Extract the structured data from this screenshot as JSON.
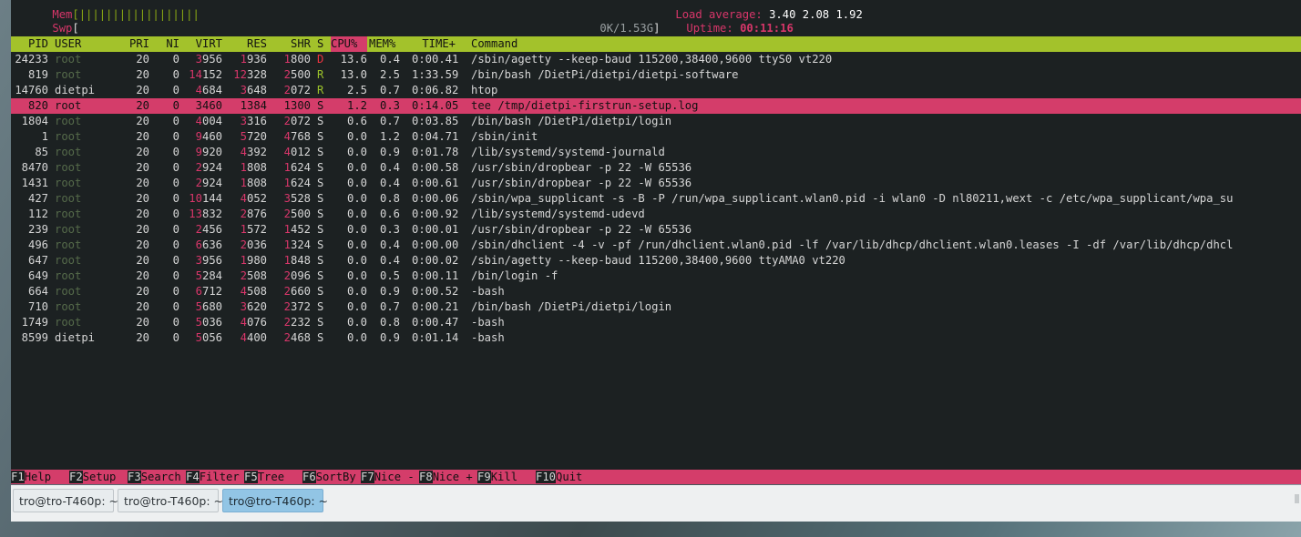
{
  "meters": {
    "mem_label": "Mem",
    "mem_bar": "[||||||||||||||||||",
    "swp_label": "Swp",
    "swp_open": "[",
    "swp_value": "0K/1.53G",
    "swp_close": "]",
    "load_label": "Load average:",
    "load_values": "3.40 2.08 1.92",
    "uptime_label": "Uptime:",
    "uptime_value": "00:11:16"
  },
  "header": {
    "pid": "PID",
    "user": "USER",
    "pri": "PRI",
    "ni": "NI",
    "virt": "VIRT",
    "res": "RES",
    "shr": "SHR",
    "s": "S",
    "cpu": "CPU%",
    "mem": "MEM%",
    "time": "TIME+",
    "command": "Command"
  },
  "processes": [
    {
      "pid": "24233",
      "user": "root",
      "pri": "20",
      "ni": "0",
      "virt_hi": "3",
      "virt": "956",
      "res_hi": "1",
      "res": "936",
      "shr_hi": "1",
      "shr": "800",
      "s": "D",
      "cpu": "13.6",
      "mem": "0.4",
      "time": "0:00.41",
      "command": "/sbin/agetty --keep-baud 115200,38400,9600 ttyS0 vt220"
    },
    {
      "pid": "819",
      "user": "root",
      "pri": "20",
      "ni": "0",
      "virt_hi": "14",
      "virt": "152",
      "res_hi": "12",
      "res": "328",
      "shr_hi": "2",
      "shr": "500",
      "s": "R",
      "cpu": "13.0",
      "mem": "2.5",
      "time": "1:33.59",
      "command": "/bin/bash /DietPi/dietpi/dietpi-software"
    },
    {
      "pid": "14760",
      "user": "dietpi",
      "pri": "20",
      "ni": "0",
      "virt_hi": "4",
      "virt": "684",
      "res_hi": "3",
      "res": "648",
      "shr_hi": "2",
      "shr": "072",
      "s": "R",
      "cpu": "2.5",
      "mem": "0.7",
      "time": "0:06.82",
      "command": "htop"
    },
    {
      "pid": "820",
      "user": "root",
      "pri": "20",
      "ni": "0",
      "virt_hi": "",
      "virt": "3460",
      "res_hi": "",
      "res": "1384",
      "shr_hi": "",
      "shr": "1300",
      "s": "S",
      "cpu": "1.2",
      "mem": "0.3",
      "time": "0:14.05",
      "command": "tee /tmp/dietpi-firstrun-setup.log"
    },
    {
      "pid": "1804",
      "user": "root",
      "pri": "20",
      "ni": "0",
      "virt_hi": "4",
      "virt": "004",
      "res_hi": "3",
      "res": "316",
      "shr_hi": "2",
      "shr": "072",
      "s": "S",
      "cpu": "0.6",
      "mem": "0.7",
      "time": "0:03.85",
      "command": "/bin/bash /DietPi/dietpi/login"
    },
    {
      "pid": "1",
      "user": "root",
      "pri": "20",
      "ni": "0",
      "virt_hi": "9",
      "virt": "460",
      "res_hi": "5",
      "res": "720",
      "shr_hi": "4",
      "shr": "768",
      "s": "S",
      "cpu": "0.0",
      "mem": "1.2",
      "time": "0:04.71",
      "command": "/sbin/init"
    },
    {
      "pid": "85",
      "user": "root",
      "pri": "20",
      "ni": "0",
      "virt_hi": "9",
      "virt": "920",
      "res_hi": "4",
      "res": "392",
      "shr_hi": "4",
      "shr": "012",
      "s": "S",
      "cpu": "0.0",
      "mem": "0.9",
      "time": "0:01.78",
      "command": "/lib/systemd/systemd-journald"
    },
    {
      "pid": "8470",
      "user": "root",
      "pri": "20",
      "ni": "0",
      "virt_hi": "2",
      "virt": "924",
      "res_hi": "1",
      "res": "808",
      "shr_hi": "1",
      "shr": "624",
      "s": "S",
      "cpu": "0.0",
      "mem": "0.4",
      "time": "0:00.58",
      "command": "/usr/sbin/dropbear -p 22 -W 65536"
    },
    {
      "pid": "1431",
      "user": "root",
      "pri": "20",
      "ni": "0",
      "virt_hi": "2",
      "virt": "924",
      "res_hi": "1",
      "res": "808",
      "shr_hi": "1",
      "shr": "624",
      "s": "S",
      "cpu": "0.0",
      "mem": "0.4",
      "time": "0:00.61",
      "command": "/usr/sbin/dropbear -p 22 -W 65536"
    },
    {
      "pid": "427",
      "user": "root",
      "pri": "20",
      "ni": "0",
      "virt_hi": "10",
      "virt": "144",
      "res_hi": "4",
      "res": "052",
      "shr_hi": "3",
      "shr": "528",
      "s": "S",
      "cpu": "0.0",
      "mem": "0.8",
      "time": "0:00.06",
      "command": "/sbin/wpa_supplicant -s -B -P /run/wpa_supplicant.wlan0.pid -i wlan0 -D nl80211,wext -c /etc/wpa_supplicant/wpa_su"
    },
    {
      "pid": "112",
      "user": "root",
      "pri": "20",
      "ni": "0",
      "virt_hi": "13",
      "virt": "832",
      "res_hi": "2",
      "res": "876",
      "shr_hi": "2",
      "shr": "500",
      "s": "S",
      "cpu": "0.0",
      "mem": "0.6",
      "time": "0:00.92",
      "command": "/lib/systemd/systemd-udevd"
    },
    {
      "pid": "239",
      "user": "root",
      "pri": "20",
      "ni": "0",
      "virt_hi": "2",
      "virt": "456",
      "res_hi": "1",
      "res": "572",
      "shr_hi": "1",
      "shr": "452",
      "s": "S",
      "cpu": "0.0",
      "mem": "0.3",
      "time": "0:00.01",
      "command": "/usr/sbin/dropbear -p 22 -W 65536"
    },
    {
      "pid": "496",
      "user": "root",
      "pri": "20",
      "ni": "0",
      "virt_hi": "6",
      "virt": "636",
      "res_hi": "2",
      "res": "036",
      "shr_hi": "1",
      "shr": "324",
      "s": "S",
      "cpu": "0.0",
      "mem": "0.4",
      "time": "0:00.00",
      "command": "/sbin/dhclient -4 -v -pf /run/dhclient.wlan0.pid -lf /var/lib/dhcp/dhclient.wlan0.leases -I -df /var/lib/dhcp/dhcl"
    },
    {
      "pid": "647",
      "user": "root",
      "pri": "20",
      "ni": "0",
      "virt_hi": "3",
      "virt": "956",
      "res_hi": "1",
      "res": "980",
      "shr_hi": "1",
      "shr": "848",
      "s": "S",
      "cpu": "0.0",
      "mem": "0.4",
      "time": "0:00.02",
      "command": "/sbin/agetty --keep-baud 115200,38400,9600 ttyAMA0 vt220"
    },
    {
      "pid": "649",
      "user": "root",
      "pri": "20",
      "ni": "0",
      "virt_hi": "5",
      "virt": "284",
      "res_hi": "2",
      "res": "508",
      "shr_hi": "2",
      "shr": "096",
      "s": "S",
      "cpu": "0.0",
      "mem": "0.5",
      "time": "0:00.11",
      "command": "/bin/login -f"
    },
    {
      "pid": "664",
      "user": "root",
      "pri": "20",
      "ni": "0",
      "virt_hi": "6",
      "virt": "712",
      "res_hi": "4",
      "res": "508",
      "shr_hi": "2",
      "shr": "660",
      "s": "S",
      "cpu": "0.0",
      "mem": "0.9",
      "time": "0:00.52",
      "command": "-bash"
    },
    {
      "pid": "710",
      "user": "root",
      "pri": "20",
      "ni": "0",
      "virt_hi": "5",
      "virt": "680",
      "res_hi": "3",
      "res": "620",
      "shr_hi": "2",
      "shr": "372",
      "s": "S",
      "cpu": "0.0",
      "mem": "0.7",
      "time": "0:00.21",
      "command": "/bin/bash /DietPi/dietpi/login"
    },
    {
      "pid": "1749",
      "user": "root",
      "pri": "20",
      "ni": "0",
      "virt_hi": "5",
      "virt": "036",
      "res_hi": "4",
      "res": "076",
      "shr_hi": "2",
      "shr": "232",
      "s": "S",
      "cpu": "0.0",
      "mem": "0.8",
      "time": "0:00.47",
      "command": "-bash"
    },
    {
      "pid": "8599",
      "user": "dietpi",
      "pri": "20",
      "ni": "0",
      "virt_hi": "5",
      "virt": "056",
      "res_hi": "4",
      "res": "400",
      "shr_hi": "2",
      "shr": "468",
      "s": "S",
      "cpu": "0.0",
      "mem": "0.9",
      "time": "0:01.14",
      "command": "-bash"
    }
  ],
  "selected_pid": "820",
  "function_keys": [
    {
      "key": "F1",
      "label": "Help"
    },
    {
      "key": "F2",
      "label": "Setup"
    },
    {
      "key": "F3",
      "label": "Search"
    },
    {
      "key": "F4",
      "label": "Filter"
    },
    {
      "key": "F5",
      "label": "Tree"
    },
    {
      "key": "F6",
      "label": "SortBy"
    },
    {
      "key": "F7",
      "label": "Nice -"
    },
    {
      "key": "F8",
      "label": "Nice +"
    },
    {
      "key": "F9",
      "label": "Kill"
    },
    {
      "key": "F10",
      "label": "Quit"
    }
  ],
  "tabs": [
    {
      "label": "tro@tro-T460p: ~",
      "active": false
    },
    {
      "label": "tro@tro-T460p: ~",
      "active": false
    },
    {
      "label": "tro@tro-T460p: ~",
      "active": true
    }
  ],
  "colors": {
    "header_bg": "#a3c22b",
    "accent": "#d43d6a",
    "terminal_bg": "#1c2122",
    "active_tab": "#92c5e5"
  }
}
